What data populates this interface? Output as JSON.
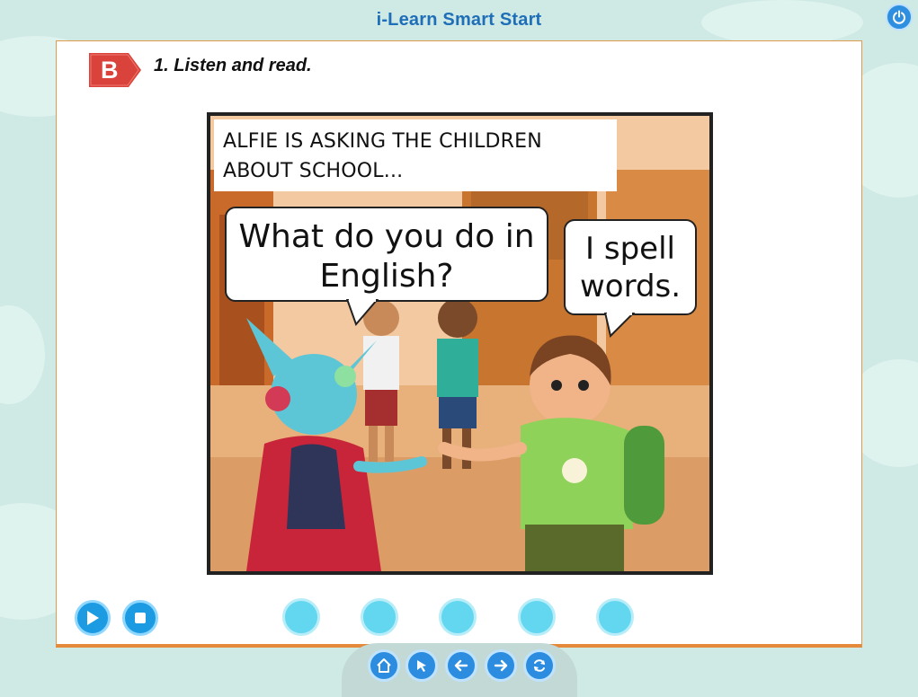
{
  "app": {
    "title": "i-Learn Smart Start"
  },
  "section": {
    "badge": "B",
    "instruction": "1. Listen and read."
  },
  "comic": {
    "caption": "ALFIE IS ASKING THE CHILDREN ABOUT SCHOOL...",
    "bubble_1": "What do you do in English?",
    "bubble_2": "I spell words."
  },
  "controls": {
    "play_icon": "play-icon",
    "stop_icon": "stop-icon",
    "track_dots": 5
  },
  "nav": [
    "home-icon",
    "pointer-icon",
    "back-arrow-icon",
    "forward-arrow-icon",
    "refresh-icon"
  ],
  "colors": {
    "accent_blue": "#1c9be3",
    "title_blue": "#1f6fb8",
    "panel_border": "#e58a3a",
    "badge_red": "#d9433b",
    "dot_cyan": "#63d6f0"
  }
}
